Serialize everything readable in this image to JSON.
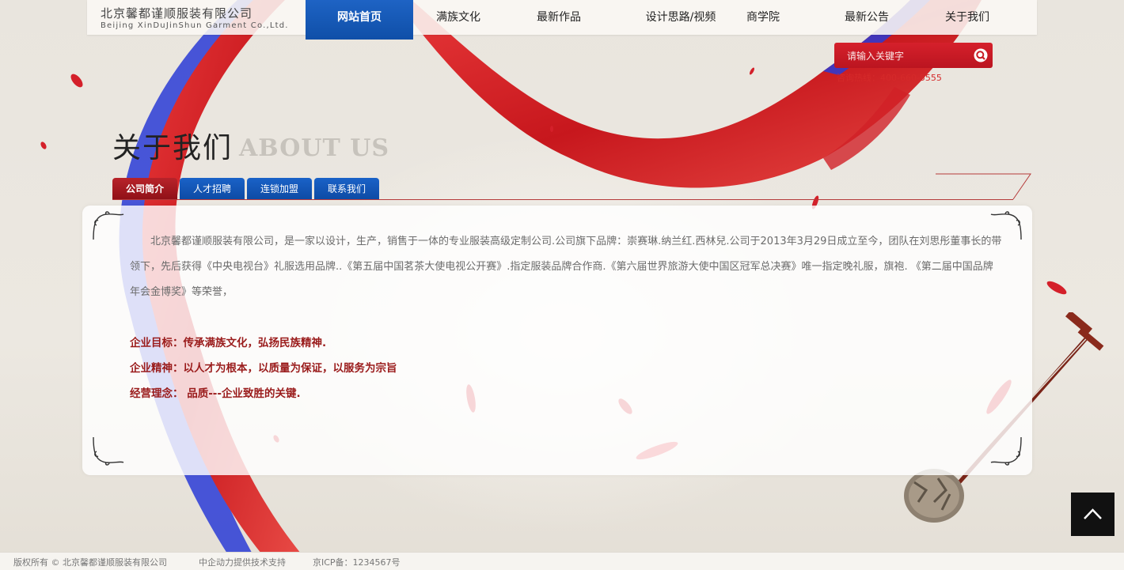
{
  "brand": {
    "name_cn": "北京馨都谨顺服装有限公司",
    "name_en": "Beijing XinDuJinShun Garment Co.,Ltd."
  },
  "nav": {
    "items": [
      {
        "label": "网站首页",
        "active": true
      },
      {
        "label": "满族文化",
        "active": false
      },
      {
        "label": "最新作品",
        "active": false
      },
      {
        "label": "设计思路/视频",
        "active": false
      },
      {
        "label": "商学院",
        "active": false
      },
      {
        "label": "最新公告",
        "active": false
      },
      {
        "label": "关于我们",
        "active": false
      }
    ]
  },
  "search": {
    "placeholder": "请输入关键字",
    "icon": "search-icon"
  },
  "hotline": "咨询热线：400-660-5555",
  "section": {
    "title_cn": "关于我们",
    "title_en": "ABOUT US"
  },
  "tabs": [
    {
      "label": "公司简介",
      "active": true
    },
    {
      "label": "人才招聘",
      "active": false
    },
    {
      "label": "连锁加盟",
      "active": false
    },
    {
      "label": "联系我们",
      "active": false
    }
  ],
  "content": {
    "intro": "北京馨都谨顺服装有限公司，是一家以设计，生产，销售于一体的专业服装高级定制公司.公司旗下品牌：崇赛琳.纳兰红.西林兒.公司于2013年3月29日成立至今，团队在刘思彤董事长的带领下，先后获得《中央电视台》礼服选用品牌..《第五届中国茗茶大使电视公开赛》.指定服装品牌合作商.《第六届世界旅游大使中国区冠军总决赛》唯一指定晚礼服，旗袍. 《第二届中国品牌年会金博奖》等荣誉，",
    "points": [
      "企业目标：传承满族文化，弘扬民族精神.",
      "企业精神：以人才为根本，以质量为保证，以服务为宗旨",
      "经营理念： 品质---企业致胜的关键."
    ]
  },
  "footer": {
    "copyright": "版权所有 © 北京馨都谨顺服装有限公司",
    "support": "中企动力提供技术支持",
    "icp": "京ICP备：1234567号"
  },
  "colors": {
    "nav_active": "#1459bd",
    "tab_active": "#a8181f",
    "search_bg": "#c81b25",
    "accent_text": "#9a1b1b",
    "hotline": "#d52a2a"
  },
  "to_top": {
    "icon": "chevron-up-icon"
  }
}
